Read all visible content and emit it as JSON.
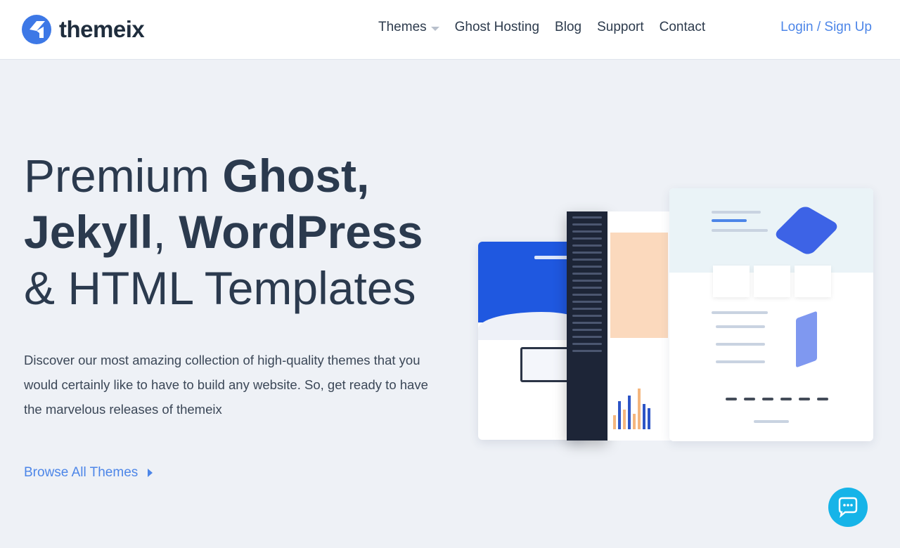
{
  "header": {
    "logo_text": "themeix",
    "nav": [
      {
        "label": "Themes",
        "has_dropdown": true
      },
      {
        "label": "Ghost Hosting"
      },
      {
        "label": "Blog"
      },
      {
        "label": "Support"
      },
      {
        "label": "Contact"
      }
    ],
    "login_label": "Login / Sign Up"
  },
  "hero": {
    "title_parts": {
      "p1": "Premium ",
      "p2": "Ghost,",
      "p3": "Jekyll",
      "p4": ", ",
      "p5": "WordPress",
      "p6": "& HTML Templates"
    },
    "description": "Discover our most amazing collection of high-quality themes that you would certainly like to have to build any website. So, get ready to have the marvelous releases of themeix",
    "browse_label": "Browse All Themes"
  },
  "colors": {
    "accent": "#4d86e8",
    "heading": "#2b3a4e",
    "background": "#eef1f6",
    "chat": "#16b4e8"
  },
  "icons": {
    "logo": "themeix-logo-icon",
    "dropdown": "caret-down-icon",
    "browse": "arrow-right-icon",
    "chat": "chat-icon"
  }
}
